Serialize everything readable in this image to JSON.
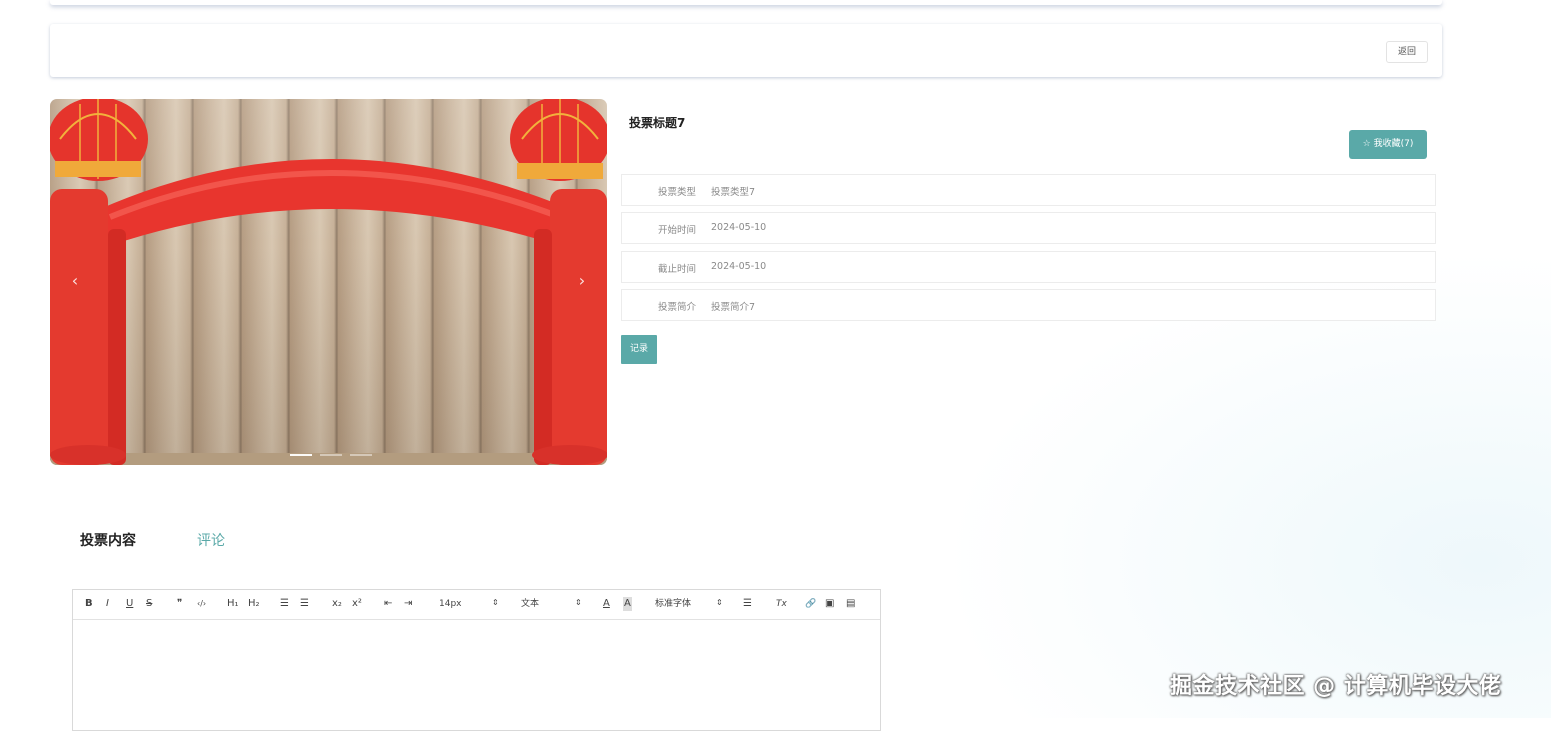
{
  "header": {
    "back_label": "返回"
  },
  "carousel": {
    "prev_icon": "‹",
    "next_icon": "›",
    "slide_count": 3,
    "active_index": 0
  },
  "detail": {
    "title": "投票标题7",
    "fav_label": "☆ 我收藏(7)",
    "fields": [
      {
        "label": "投票类型",
        "value": "投票类型7"
      },
      {
        "label": "开始时间",
        "value": "2024-05-10"
      },
      {
        "label": "截止时间",
        "value": "2024-05-10"
      },
      {
        "label": "投票简介",
        "value": "投票简介7"
      }
    ],
    "record_label": "记录"
  },
  "tabs": [
    {
      "label": "投票内容",
      "active": true
    },
    {
      "label": "评论",
      "active": false
    }
  ],
  "editor": {
    "toolbar": {
      "bold": "B",
      "italic": "I",
      "underline": "U",
      "strike": "S",
      "quote": "❞",
      "code": "‹/›",
      "h1": "H₁",
      "h2": "H₂",
      "ordered_list": "☰",
      "bullet_list": "☰",
      "subscript": "x₂",
      "superscript": "x²",
      "outdent": "⇤",
      "indent": "⇥",
      "size_value": "14px",
      "text_value": "文本",
      "font_color": "A",
      "bg_color": "A",
      "font_value": "标准字体",
      "align": "☰",
      "clear": "Tx",
      "link": "🔗",
      "image": "▣",
      "video": "▤",
      "caret": "⇕"
    }
  },
  "watermark": "掘金技术社区 @ 计算机毕设大佬",
  "colors": {
    "accent": "#5aa9a8",
    "arch_red": "#e8352e"
  }
}
